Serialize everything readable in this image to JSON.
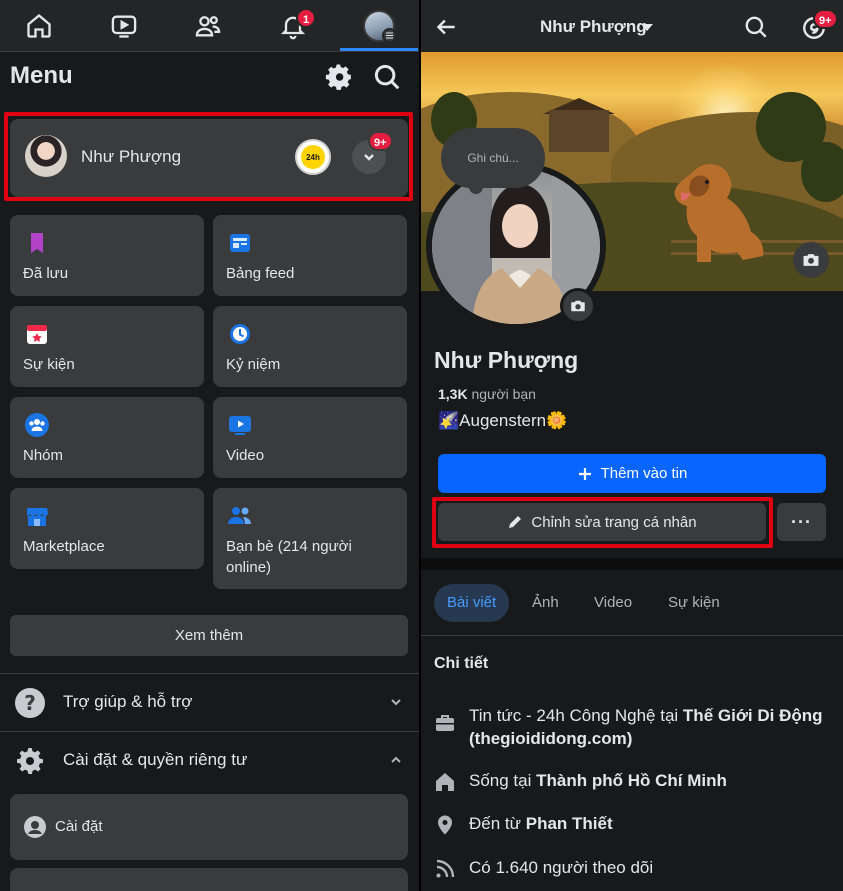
{
  "left": {
    "nav": {
      "notif_badge": "1"
    },
    "menu_title": "Menu",
    "profile": {
      "name": "Như Phượng",
      "badge": "9+",
      "app_icon_text": "24h"
    },
    "tiles": [
      {
        "label": "Đã lưu",
        "icon": "bookmark-icon",
        "color": "#b243c9"
      },
      {
        "label": "Bảng feed",
        "icon": "feed-icon",
        "color": "#1b74e4"
      },
      {
        "label": "Sự kiện",
        "icon": "calendar-star-icon",
        "color": "#f02849"
      },
      {
        "label": "Kỷ niệm",
        "icon": "memories-clock-icon",
        "color": "#1b74e4"
      },
      {
        "label": "Nhóm",
        "icon": "groups-icon",
        "color": "#1b74e4"
      },
      {
        "label": "Video",
        "icon": "video-icon",
        "color": "#1b74e4"
      },
      {
        "label": "Marketplace",
        "icon": "marketplace-icon",
        "color": "#1b74e4"
      },
      {
        "label": "Bạn bè (214 người online)",
        "icon": "friends-icon",
        "color": "#1b74e4"
      }
    ],
    "see_more": "Xem thêm",
    "help": "Trợ giúp & hỗ trợ",
    "settings_privacy": "Cài đặt & quyền riêng tư",
    "settings": "Cài đặt"
  },
  "right": {
    "header_name": "Như Phượng",
    "msg_badge": "9+",
    "note_placeholder": "Ghi chú...",
    "name": "Như Phượng",
    "friends_count": "1,3K",
    "friends_label": "người bạn",
    "bio_emoji_left": "🌠",
    "bio_text": "Augenstern",
    "bio_emoji_right": "🌼",
    "add_story": "Thêm vào tin",
    "edit_profile": "Chỉnh sửa trang cá nhân",
    "more": "···",
    "tabs": [
      "Bài viết",
      "Ảnh",
      "Video",
      "Sự kiện"
    ],
    "details_title": "Chi tiết",
    "details": {
      "work_prefix": "Tin tức - 24h Công Nghệ tại ",
      "work_place": "Thế Giới Di Động (thegioididong.com)",
      "live_prefix": "Sống tại ",
      "live_place": "Thành phố Hồ Chí Minh",
      "from_prefix": "Đến từ ",
      "from_place": "Phan Thiết",
      "followers": "Có 1.640 người theo dõi"
    }
  },
  "colors": {
    "bg": "#18191a",
    "card": "#3a3b3c",
    "accent": "#0866ff",
    "highlight": "#e00014",
    "badge": "#e41e3f"
  }
}
